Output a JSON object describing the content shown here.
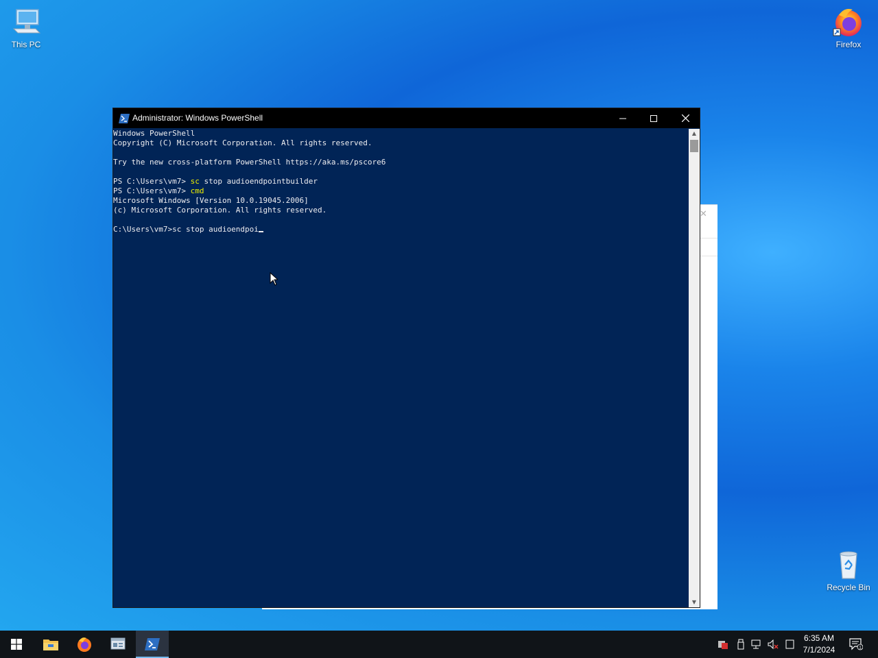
{
  "desktop": {
    "icons": [
      {
        "label": "This PC",
        "icon": "this-pc-icon"
      },
      {
        "label": "Firefox",
        "icon": "firefox-icon"
      },
      {
        "label": "Recycle Bin",
        "icon": "recycle-bin-icon"
      }
    ]
  },
  "powershell": {
    "title": "Administrator: Windows PowerShell",
    "icon": "powershell-icon",
    "lines": [
      {
        "prefix": "Windows PowerShell",
        "cmd": "",
        "rest": ""
      },
      {
        "prefix": "Copyright (C) Microsoft Corporation. All rights reserved.",
        "cmd": "",
        "rest": ""
      },
      {
        "prefix": "",
        "cmd": "",
        "rest": ""
      },
      {
        "prefix": "Try the new cross-platform PowerShell https://aka.ms/pscore6",
        "cmd": "",
        "rest": ""
      },
      {
        "prefix": "",
        "cmd": "",
        "rest": ""
      },
      {
        "prefix": "PS C:\\Users\\vm7> ",
        "cmd": "sc",
        "rest": " stop audioendpointbuilder"
      },
      {
        "prefix": "PS C:\\Users\\vm7> ",
        "cmd": "cmd",
        "rest": ""
      },
      {
        "prefix": "Microsoft Windows [Version 10.0.19045.2006]",
        "cmd": "",
        "rest": ""
      },
      {
        "prefix": "(c) Microsoft Corporation. All rights reserved.",
        "cmd": "",
        "rest": ""
      },
      {
        "prefix": "",
        "cmd": "",
        "rest": ""
      },
      {
        "prefix": "C:\\Users\\vm7>sc stop audioendpoi",
        "cmd": "",
        "rest": ""
      }
    ],
    "colors": {
      "background": "#012456",
      "text": "#eeedf0",
      "command": "#f0f000"
    }
  },
  "taskbar": {
    "buttons": [
      {
        "name": "start-button",
        "icon": "windows-logo-icon"
      },
      {
        "name": "file-explorer-button",
        "icon": "folder-icon"
      },
      {
        "name": "firefox-button",
        "icon": "firefox-icon"
      },
      {
        "name": "app-button",
        "icon": "window-app-icon"
      },
      {
        "name": "powershell-button",
        "icon": "powershell-icon",
        "active": true
      }
    ],
    "tray": [
      "security-icon",
      "usb-icon",
      "network-icon",
      "volume-muted-icon",
      "input-icon"
    ],
    "clock": {
      "time": "6:35 AM",
      "date": "7/1/2024"
    },
    "notifications": {
      "count": "1"
    }
  }
}
